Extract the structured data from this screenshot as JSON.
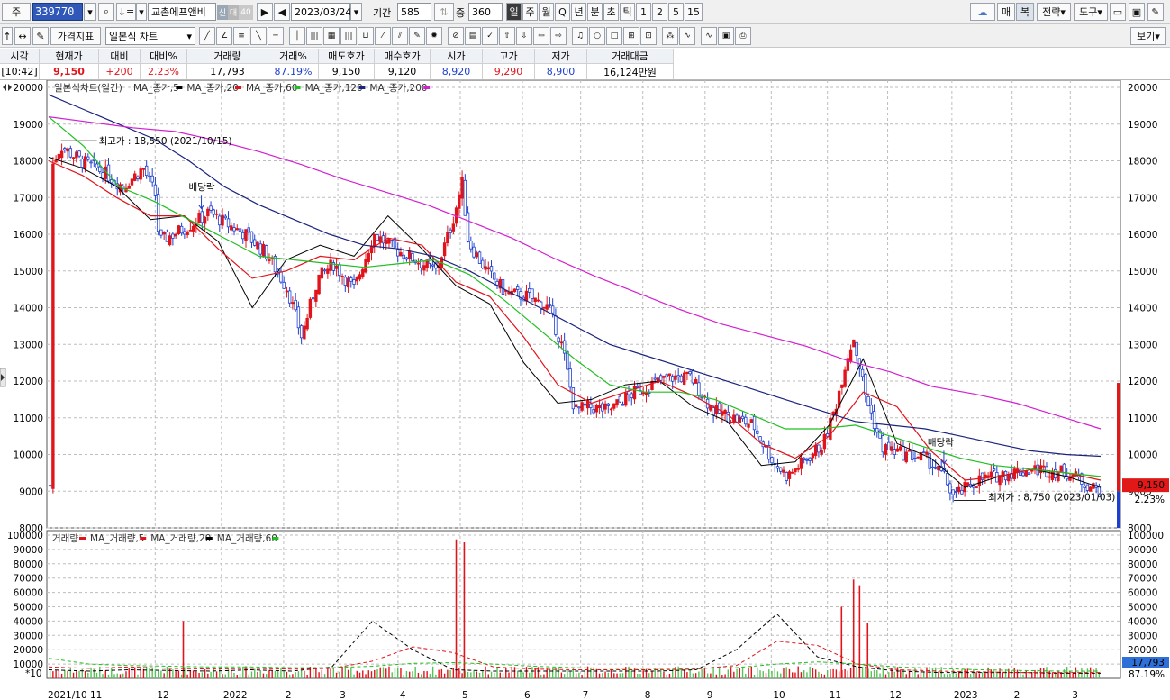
{
  "toolbar": {
    "market_label": "주",
    "stock_code": "339770",
    "stock_name": "교촌에프앤비",
    "tag_credit": "신",
    "tag_rank": "대",
    "tag_group": "40",
    "date": "2023/03/24",
    "period_label": "기간",
    "period_value": "585",
    "overlap_label": "중",
    "overlap_value": "360",
    "cycle_tabs": [
      "일",
      "주",
      "월",
      "Q",
      "년",
      "분",
      "초",
      "틱",
      "1",
      "2",
      "5",
      "15"
    ],
    "active_cycle": "일",
    "right_buttons": [
      "매",
      "복",
      "전략",
      "도구"
    ],
    "indicator_button": "가격지표",
    "chart_type_select": "일본식 차트",
    "view_button": "보기"
  },
  "quote": {
    "headers": [
      "시각",
      "현재가",
      "대비",
      "대비%",
      "거래량",
      "거래%",
      "매도호가",
      "매수호가",
      "시가",
      "고가",
      "저가",
      "거래대금"
    ],
    "values": [
      "[10:42]",
      "9,150",
      "+200",
      "2.23%",
      "17,793",
      "87.19%",
      "9,150",
      "9,120",
      "8,920",
      "9,290",
      "8,900",
      "16,124만원"
    ]
  },
  "legend": {
    "price_title": "일본식차트(일간)",
    "price_mas": [
      "MA_종가,5",
      "MA_종가,20",
      "MA_종가,60",
      "MA_종가,120",
      "MA_종가,200"
    ],
    "volume_title": "거래량",
    "volume_mas": [
      "MA_거래량,5",
      "MA_거래량,20",
      "MA_거래량,60"
    ]
  },
  "annotations": {
    "high": "최고가 : 18,550 (2021/10/15)",
    "low": "최저가 : 8,750 (2023/01/03)",
    "dividend_1": "배당락",
    "dividend_2": "배당락"
  },
  "right_badges": {
    "price": "9,150",
    "change_pct": "2.23%",
    "volume": "17,793",
    "volume_pct": "87.19%"
  },
  "x_axis_labels": [
    "2021/10 11",
    "12",
    "2022",
    "2",
    "3",
    "4",
    "5",
    "6",
    "7",
    "8",
    "9",
    "10",
    "11",
    "12",
    "2023",
    "2",
    "3"
  ],
  "volume_multiplier_label": "*10",
  "colors": {
    "up": "#e0141b",
    "down": "#1d3fcf",
    "ma5": "#000000",
    "ma20": "#e0141b",
    "ma60": "#1fc01f",
    "ma120": "#1a237e",
    "ma200": "#d21fd2"
  },
  "chart_data": {
    "type": "candlestick",
    "title": "일본식차트(일간)",
    "price_ylim": [
      8000,
      20000
    ],
    "price_ticks": [
      8000,
      9000,
      10000,
      11000,
      12000,
      13000,
      14000,
      15000,
      16000,
      17000,
      18000,
      19000,
      20000
    ],
    "volume_ylim": [
      0,
      100000
    ],
    "volume_ticks": [
      10000,
      20000,
      30000,
      40000,
      50000,
      60000,
      70000,
      80000,
      90000,
      100000
    ],
    "grid": true,
    "close_path": [
      {
        "x": "2021/10/11",
        "y": 17900
      },
      {
        "x": "2021/10/15",
        "y": 18400
      },
      {
        "x": "2021/10/25",
        "y": 18000
      },
      {
        "x": "2021/11/05",
        "y": 17700
      },
      {
        "x": "2021/11/15",
        "y": 17300
      },
      {
        "x": "2021/11/25",
        "y": 17800
      },
      {
        "x": "2021/12/01",
        "y": 17100
      },
      {
        "x": "2021/12/03",
        "y": 15800
      },
      {
        "x": "2021/12/10",
        "y": 16000
      },
      {
        "x": "2021/12/20",
        "y": 16300
      },
      {
        "x": "2021/12/28",
        "y": 16600
      },
      {
        "x": "2022/01/05",
        "y": 16300
      },
      {
        "x": "2022/01/15",
        "y": 16000
      },
      {
        "x": "2022/01/25",
        "y": 15500
      },
      {
        "x": "2022/02/05",
        "y": 14500
      },
      {
        "x": "2022/02/12",
        "y": 13200
      },
      {
        "x": "2022/02/20",
        "y": 14800
      },
      {
        "x": "2022/02/28",
        "y": 15200
      },
      {
        "x": "2022/03/10",
        "y": 14500
      },
      {
        "x": "2022/03/20",
        "y": 16000
      },
      {
        "x": "2022/03/30",
        "y": 15600
      },
      {
        "x": "2022/04/10",
        "y": 15300
      },
      {
        "x": "2022/04/20",
        "y": 15000
      },
      {
        "x": "2022/04/28",
        "y": 16300
      },
      {
        "x": "2022/05/03",
        "y": 17400
      },
      {
        "x": "2022/05/06",
        "y": 15800
      },
      {
        "x": "2022/05/15",
        "y": 15000
      },
      {
        "x": "2022/05/25",
        "y": 14400
      },
      {
        "x": "2022/06/05",
        "y": 14300
      },
      {
        "x": "2022/06/15",
        "y": 14000
      },
      {
        "x": "2022/06/22",
        "y": 12900
      },
      {
        "x": "2022/06/28",
        "y": 11200
      },
      {
        "x": "2022/07/05",
        "y": 11300
      },
      {
        "x": "2022/07/15",
        "y": 11200
      },
      {
        "x": "2022/07/25",
        "y": 11600
      },
      {
        "x": "2022/08/05",
        "y": 11900
      },
      {
        "x": "2022/08/15",
        "y": 12100
      },
      {
        "x": "2022/08/25",
        "y": 12100
      },
      {
        "x": "2022/09/05",
        "y": 11200
      },
      {
        "x": "2022/09/15",
        "y": 11000
      },
      {
        "x": "2022/09/25",
        "y": 10800
      },
      {
        "x": "2022/10/05",
        "y": 9800
      },
      {
        "x": "2022/10/12",
        "y": 9400
      },
      {
        "x": "2022/10/20",
        "y": 9800
      },
      {
        "x": "2022/10/30",
        "y": 10300
      },
      {
        "x": "2022/11/05",
        "y": 11300
      },
      {
        "x": "2022/11/10",
        "y": 12500
      },
      {
        "x": "2022/11/14",
        "y": 13200
      },
      {
        "x": "2022/11/20",
        "y": 11600
      },
      {
        "x": "2022/11/28",
        "y": 10200
      },
      {
        "x": "2022/12/10",
        "y": 10000
      },
      {
        "x": "2022/12/20",
        "y": 9900
      },
      {
        "x": "2022/12/29",
        "y": 9400
      },
      {
        "x": "2023/01/03",
        "y": 8850
      },
      {
        "x": "2023/01/15",
        "y": 9300
      },
      {
        "x": "2023/01/30",
        "y": 9500
      },
      {
        "x": "2023/02/15",
        "y": 9600
      },
      {
        "x": "2023/03/01",
        "y": 9500
      },
      {
        "x": "2023/03/10",
        "y": 9200
      },
      {
        "x": "2023/03/17",
        "y": 9000
      },
      {
        "x": "2023/03/24",
        "y": 9150
      }
    ],
    "series": [
      {
        "name": "MA_종가,5",
        "values": [
          18100,
          17800,
          17300,
          16400,
          16500,
          15800,
          14000,
          15300,
          15700,
          15400,
          16500,
          15600,
          14600,
          14100,
          12500,
          11400,
          11500,
          11900,
          12000,
          11300,
          10900,
          9700,
          9800,
          10800,
          12600,
          10300,
          9900,
          9100,
          9400,
          9600,
          9400,
          9100
        ]
      },
      {
        "name": "MA_종가,20",
        "values": [
          18000,
          17600,
          17000,
          16500,
          16500,
          15600,
          14800,
          15000,
          15400,
          15300,
          15900,
          15700,
          14700,
          14300,
          13200,
          11900,
          11400,
          11700,
          12000,
          11600,
          11100,
          10300,
          9900,
          10500,
          11700,
          11300,
          10100,
          9300,
          9400,
          9600,
          9500,
          9300
        ]
      },
      {
        "name": "MA_종가,60",
        "values": [
          19200,
          18400,
          17300,
          16900,
          16400,
          15900,
          15400,
          15300,
          15200,
          15100,
          15200,
          15300,
          14900,
          14200,
          13400,
          12600,
          11900,
          11700,
          11700,
          11500,
          11100,
          10700,
          10700,
          10800,
          10500,
          10200,
          9900,
          9700,
          9600,
          9500,
          9400
        ]
      },
      {
        "name": "MA_종가,120",
        "values": [
          19800,
          19400,
          19000,
          18600,
          18000,
          17300,
          16800,
          16400,
          16000,
          15700,
          15600,
          15400,
          15000,
          14500,
          14000,
          13500,
          13000,
          12700,
          12400,
          12100,
          11800,
          11500,
          11200,
          10900,
          10800,
          10700,
          10500,
          10300,
          10100,
          10000,
          9950
        ]
      },
      {
        "name": "MA_종가,200",
        "values": [
          19200,
          19050,
          18900,
          18800,
          18550,
          18250,
          17900,
          17500,
          17150,
          16800,
          16350,
          15900,
          15350,
          14850,
          14400,
          13950,
          13550,
          13250,
          12950,
          12550,
          12250,
          11850,
          11650,
          11400,
          11050,
          10700
        ]
      }
    ],
    "volume_spikes": [
      {
        "x": "2021/12/15",
        "y": 40000
      },
      {
        "x": "2022/04/30",
        "y": 97000
      },
      {
        "x": "2022/05/04",
        "y": 95000
      },
      {
        "x": "2022/11/08",
        "y": 50000
      },
      {
        "x": "2022/11/14",
        "y": 69000
      },
      {
        "x": "2022/11/17",
        "y": 65000
      },
      {
        "x": "2022/11/21",
        "y": 39000
      }
    ],
    "annotation_high": {
      "x": "2021/10/15",
      "y": 18550
    },
    "annotation_low": {
      "x": "2023/01/03",
      "y": 8750
    }
  }
}
